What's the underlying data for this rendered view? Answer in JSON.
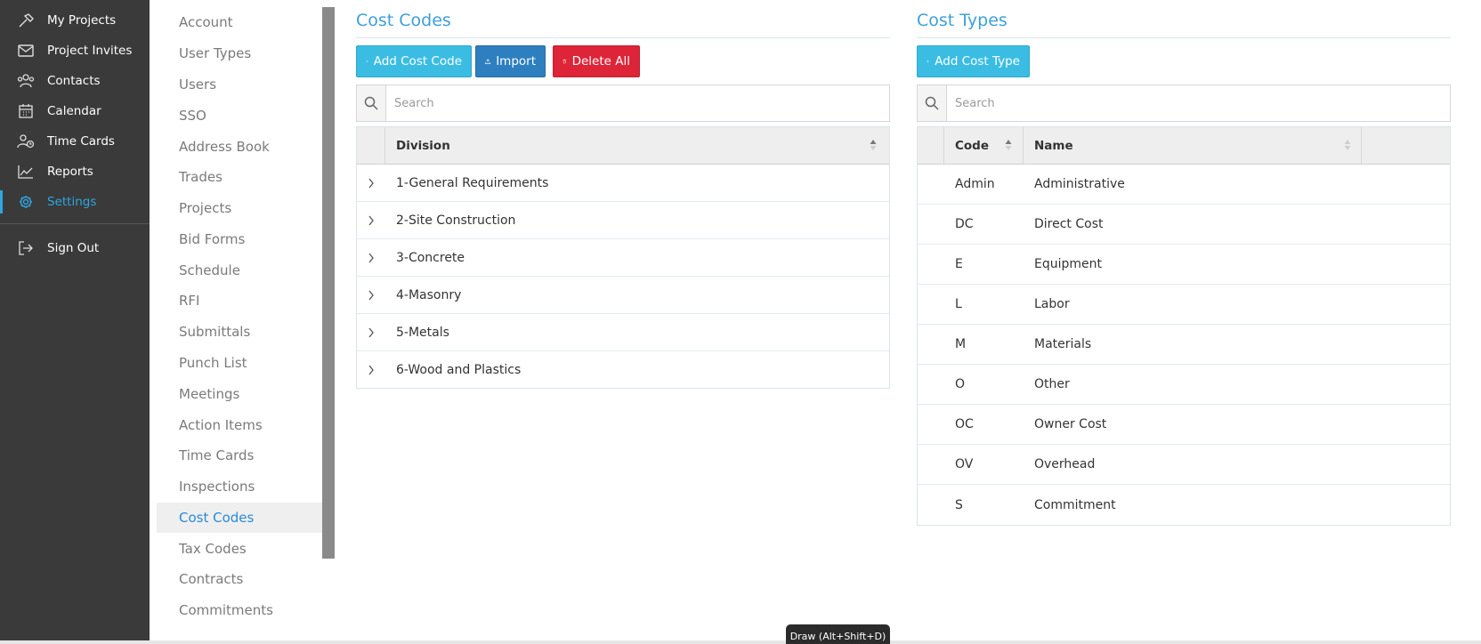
{
  "nav": {
    "items": [
      {
        "label": "My Projects",
        "icon": "hammer-icon"
      },
      {
        "label": "Project Invites",
        "icon": "envelope-icon"
      },
      {
        "label": "Contacts",
        "icon": "people-icon"
      },
      {
        "label": "Calendar",
        "icon": "calendar-icon"
      },
      {
        "label": "Time Cards",
        "icon": "user-clock-icon"
      },
      {
        "label": "Reports",
        "icon": "line-chart-icon"
      },
      {
        "label": "Settings",
        "icon": "gear-icon"
      }
    ],
    "signout": {
      "label": "Sign Out",
      "icon": "sign-out-icon"
    },
    "active": "Settings"
  },
  "submenu": {
    "items": [
      "Account",
      "User Types",
      "Users",
      "SSO",
      "Address Book",
      "Trades",
      "Projects",
      "Bid Forms",
      "Schedule",
      "RFI",
      "Submittals",
      "Punch List",
      "Meetings",
      "Action Items",
      "Time Cards",
      "Inspections",
      "Cost Codes",
      "Tax Codes",
      "Contracts",
      "Commitments"
    ],
    "active": "Cost Codes"
  },
  "cost_codes": {
    "title": "Cost Codes",
    "buttons": {
      "add": "Add Cost Code",
      "import": "Import",
      "delete_all": "Delete All"
    },
    "search": {
      "placeholder": "Search",
      "value": ""
    },
    "header": {
      "division": "Division"
    },
    "rows": [
      "1-General Requirements",
      "2-Site Construction",
      "3-Concrete",
      "4-Masonry",
      "5-Metals",
      "6-Wood and Plastics"
    ]
  },
  "cost_types": {
    "title": "Cost Types",
    "buttons": {
      "add": "Add Cost Type"
    },
    "search": {
      "placeholder": "Search",
      "value": ""
    },
    "header": {
      "code": "Code",
      "name": "Name"
    },
    "rows": [
      {
        "code": "Admin",
        "name": "Administrative"
      },
      {
        "code": "DC",
        "name": "Direct Cost"
      },
      {
        "code": "E",
        "name": "Equipment"
      },
      {
        "code": "L",
        "name": "Labor"
      },
      {
        "code": "M",
        "name": "Materials"
      },
      {
        "code": "O",
        "name": "Other"
      },
      {
        "code": "OC",
        "name": "Owner Cost"
      },
      {
        "code": "OV",
        "name": "Overhead"
      },
      {
        "code": "S",
        "name": "Commitment"
      }
    ]
  },
  "tooltip": "Draw (Alt+Shift+D)",
  "colors": {
    "nav_bg": "#3a3a3a",
    "accent": "#2ea6e0",
    "cyan_button": "#3bbde3",
    "blue_button": "#2e7fbf",
    "danger": "#dd2438"
  }
}
